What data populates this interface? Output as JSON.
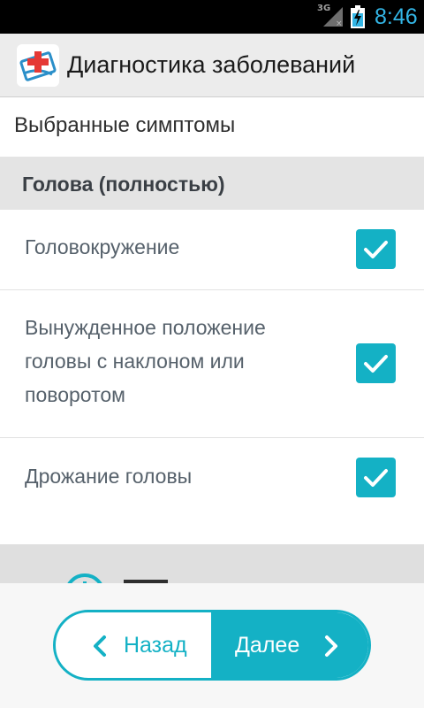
{
  "status_bar": {
    "network": "3G",
    "time": "8:46"
  },
  "app_bar": {
    "title": "Диагностика заболеваний",
    "icon": "medical-cross-icon"
  },
  "section_title": "Выбранные симптомы",
  "group": {
    "title": "Голова (полностью)",
    "items": [
      {
        "label": "Головокружение",
        "checked": true
      },
      {
        "label": "Вынужденное положение головы с наклоном или поворотом",
        "checked": true
      },
      {
        "label": "Дрожание головы",
        "checked": true
      }
    ]
  },
  "nav": {
    "back_label": "Назад",
    "next_label": "Далее"
  },
  "colors": {
    "accent": "#14b1c5",
    "clock": "#33b5e5",
    "header_bg": "#e4e4e4"
  }
}
